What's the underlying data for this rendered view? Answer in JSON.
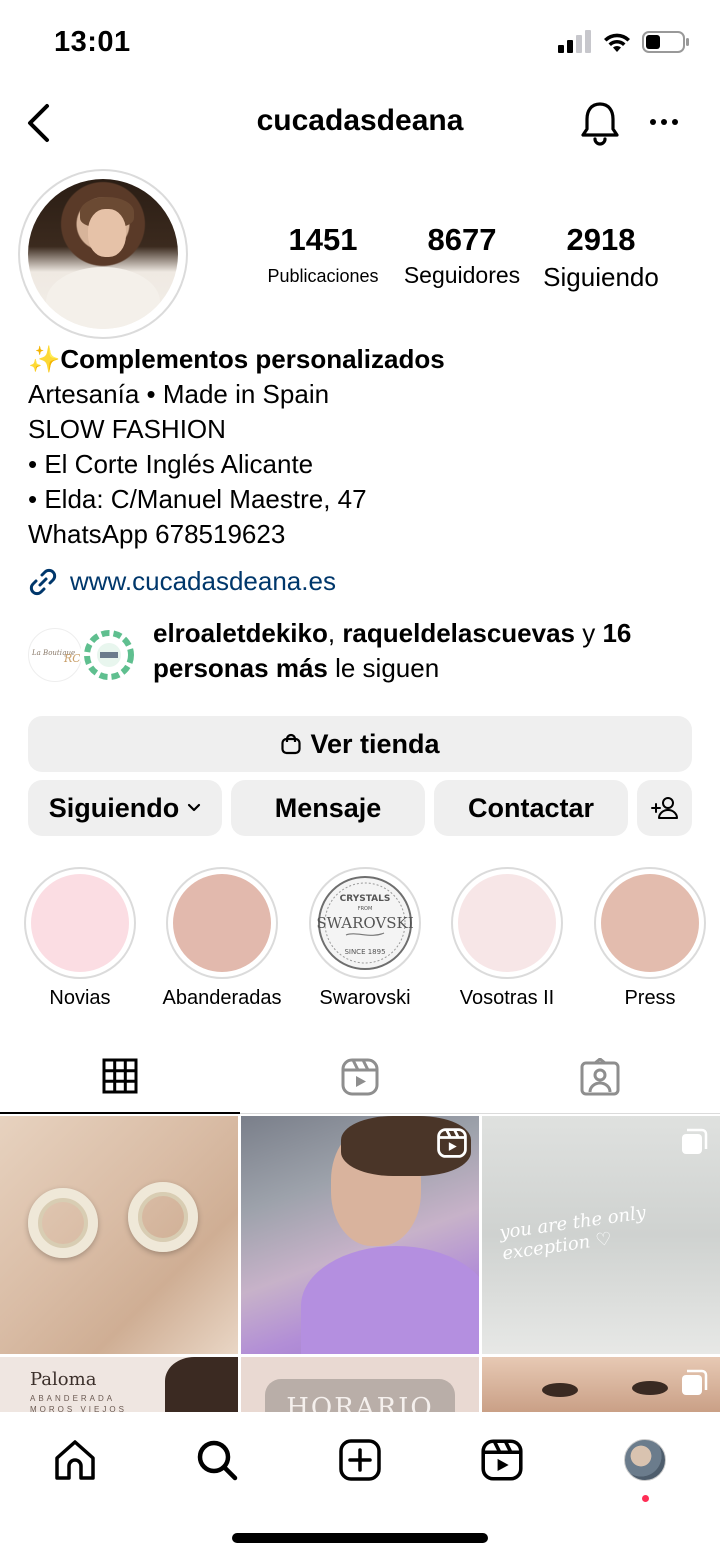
{
  "status_bar": {
    "time": "13:01"
  },
  "header": {
    "username": "cucadasdeana"
  },
  "stats": [
    {
      "count": "1451",
      "label": "Publicaciones"
    },
    {
      "count": "8677",
      "label": "Seguidores"
    },
    {
      "count": "2918",
      "label": "Siguiendo"
    }
  ],
  "bio": {
    "title_emoji": "✨",
    "title": "Complementos personalizados",
    "lines": [
      "Artesanía • Made in Spain",
      "SLOW FASHION",
      "• El Corte Inglés Alicante",
      "• Elda: C/Manuel Maestre, 47",
      "WhatsApp 678519623"
    ],
    "link": "www.cucadasdeana.es"
  },
  "followed_by": {
    "user1": "elroaletdekiko",
    "separator": ", ",
    "user2": "raqueldelascuevas",
    "joiner": " y ",
    "others": "16 personas más",
    "suffix": " le siguen"
  },
  "actions": {
    "shop": "Ver tienda",
    "following": "Siguiendo",
    "message": "Mensaje",
    "contact": "Contactar"
  },
  "highlights": [
    {
      "label": "Novias",
      "color": "#fbdde3"
    },
    {
      "label": "Abanderadas",
      "color": "#e2b9ad"
    },
    {
      "label": "Swarovski",
      "color": "#ffffff"
    },
    {
      "label": "Vosotras II",
      "color": "#f7e6e7"
    },
    {
      "label": "Press",
      "color": "#e3bcae"
    }
  ],
  "swarovski_logo": {
    "top": "CRYSTALS",
    "from": "FROM",
    "brand": "SWAROVSKI",
    "since": "SINCE 1895"
  },
  "posts": {
    "p3_caption": "you are the only exception ♡",
    "p4_title": "Paloma",
    "p4_sub_1": "ABANDERADA",
    "p4_sub_2": "MOROS VIEJOS",
    "p5_text": "HORARIO"
  }
}
